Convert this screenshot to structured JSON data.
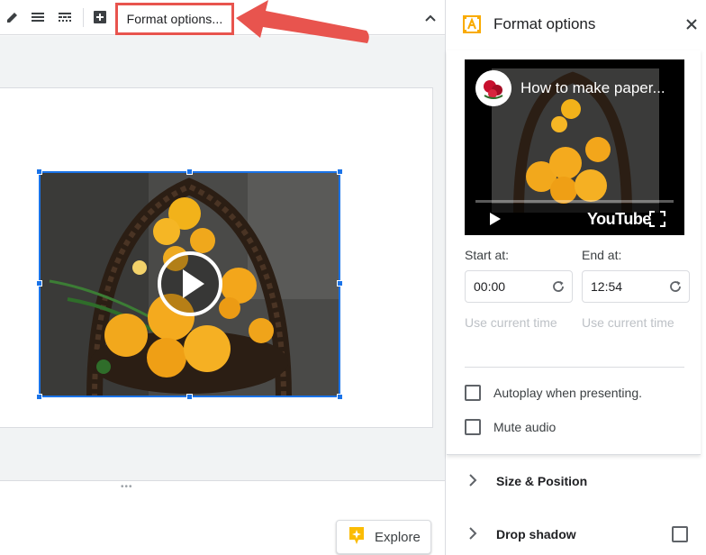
{
  "toolbar": {
    "format_options_label": "Format options..."
  },
  "explore": {
    "label": "Explore"
  },
  "panel": {
    "title": "Format options",
    "video_title": "How to make paper...",
    "video_brand": "YouTube",
    "start": {
      "label": "Start at:",
      "value": "00:00",
      "use_current": "Use current time"
    },
    "end": {
      "label": "End at:",
      "value": "12:54",
      "use_current": "Use current time"
    },
    "autoplay_label": "Autoplay when presenting.",
    "mute_label": "Mute audio",
    "sections": [
      {
        "label": "Size & Position"
      },
      {
        "label": "Drop shadow"
      }
    ]
  },
  "colors": {
    "accent_blue": "#1a73e8",
    "annotation_red": "#e8544e",
    "explore_yellow": "#fbbc04",
    "panel_icon_orange": "#f9ab00"
  }
}
